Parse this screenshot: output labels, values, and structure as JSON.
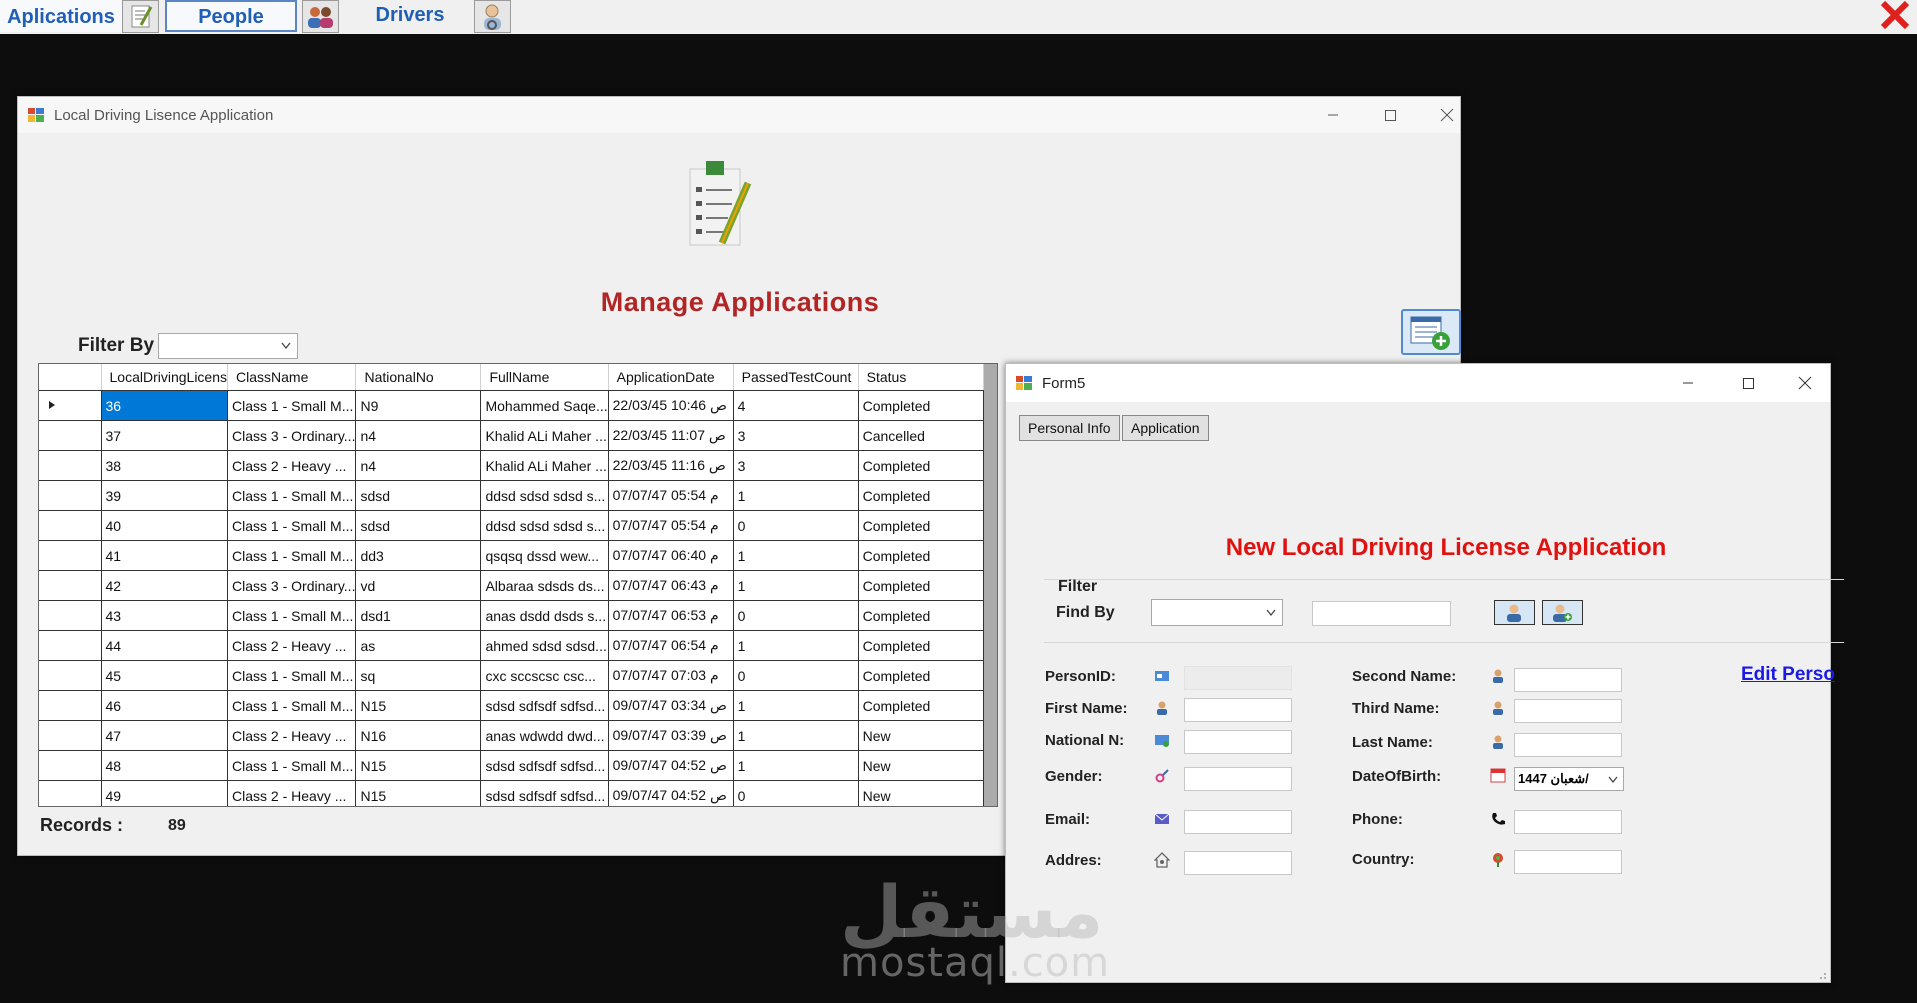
{
  "menubar": {
    "applications_label": "Aplications",
    "people_label": "People",
    "drivers_label": "Drivers"
  },
  "manage_window": {
    "title": "Local Driving Lisence Application",
    "heading": "Manage Applications",
    "filter_label": "Filter By",
    "filter_value": "",
    "columns": [
      "LocalDrivingLicens",
      "ClassName",
      "NationalNo",
      "FullName",
      "ApplicationDate",
      "PassedTestCount",
      "Status"
    ],
    "rows": [
      [
        "36",
        "Class 1 - Small M...",
        "N9",
        "Mohammed Saqe...",
        "22/03/45 10:46 ص",
        "4",
        "Completed"
      ],
      [
        "37",
        "Class 3 - Ordinary...",
        "n4",
        "Khalid ALi Maher ...",
        "22/03/45 11:07 ص",
        "3",
        "Cancelled"
      ],
      [
        "38",
        "Class 2 - Heavy ...",
        "n4",
        "Khalid ALi Maher ...",
        "22/03/45 11:16 ص",
        "3",
        "Completed"
      ],
      [
        "39",
        "Class 1 - Small M...",
        "sdsd",
        "ddsd sdsd sdsd s...",
        "07/07/47 05:54 م",
        "1",
        "Completed"
      ],
      [
        "40",
        "Class 1 - Small M...",
        "sdsd",
        "ddsd sdsd sdsd s...",
        "07/07/47 05:54 م",
        "0",
        "Completed"
      ],
      [
        "41",
        "Class 1 - Small M...",
        "dd3",
        "qsqsq dssd wew...",
        "07/07/47 06:40 م",
        "1",
        "Completed"
      ],
      [
        "42",
        "Class 3 - Ordinary...",
        "vd",
        "Albaraa sdsds ds...",
        "07/07/47 06:43 م",
        "1",
        "Completed"
      ],
      [
        "43",
        "Class 1 - Small M...",
        "dsd1",
        "anas dsdd dsds s...",
        "07/07/47 06:53 م",
        "0",
        "Completed"
      ],
      [
        "44",
        "Class 2 - Heavy ...",
        "as",
        "ahmed sdsd sdsd...",
        "07/07/47 06:54 م",
        "1",
        "Completed"
      ],
      [
        "45",
        "Class 1 - Small M...",
        "sq",
        "cxc sccscsc csc...",
        "07/07/47 07:03 م",
        "0",
        "Completed"
      ],
      [
        "46",
        "Class 1 - Small M...",
        "N15",
        "sdsd sdfsdf sdfsd...",
        "09/07/47 03:34 ص",
        "1",
        "Completed"
      ],
      [
        "47",
        "Class 2 - Heavy ...",
        "N16",
        "anas wdwdd dwd...",
        "09/07/47 03:39 ص",
        "1",
        "New"
      ],
      [
        "48",
        "Class 1 - Small M...",
        "N15",
        "sdsd sdfsdf sdfsd...",
        "09/07/47 04:52 ص",
        "1",
        "New"
      ],
      [
        "49",
        "Class 2 - Heavy ...",
        "N15",
        "sdsd sdfsdf sdfsd...",
        "09/07/47 04:52 ص",
        "0",
        "New"
      ]
    ],
    "selected_row": 0,
    "records_label": "Records :",
    "records_value": "89"
  },
  "form5": {
    "title": "Form5",
    "tabs": [
      "Personal Info",
      "Application"
    ],
    "heading": "New Local Driving License Application",
    "filter_group_label": "Filter",
    "find_by_label": "Find By",
    "find_by_value": "",
    "find_text": "",
    "fields_left": [
      "PersonID:",
      "First Name:",
      "National N:",
      "Gender:",
      "Email:",
      "Addres:"
    ],
    "fields_right": [
      "Second Name:",
      "Third Name:",
      "Last Name:",
      "DateOfBirth:",
      "Phone:",
      "Country:"
    ],
    "dob_value": "شعبان 1447/",
    "edit_person_link": "Edit Perso"
  },
  "watermark": {
    "arabic": "مستقل",
    "latin": "mostaql.com"
  },
  "colors": {
    "menu_text": "#1f5fb5",
    "manage_heading": "#b22525",
    "form5_heading": "#e0120f",
    "selection": "#0078d7",
    "link": "#1a1ae6",
    "close_x": "#e0201c"
  }
}
